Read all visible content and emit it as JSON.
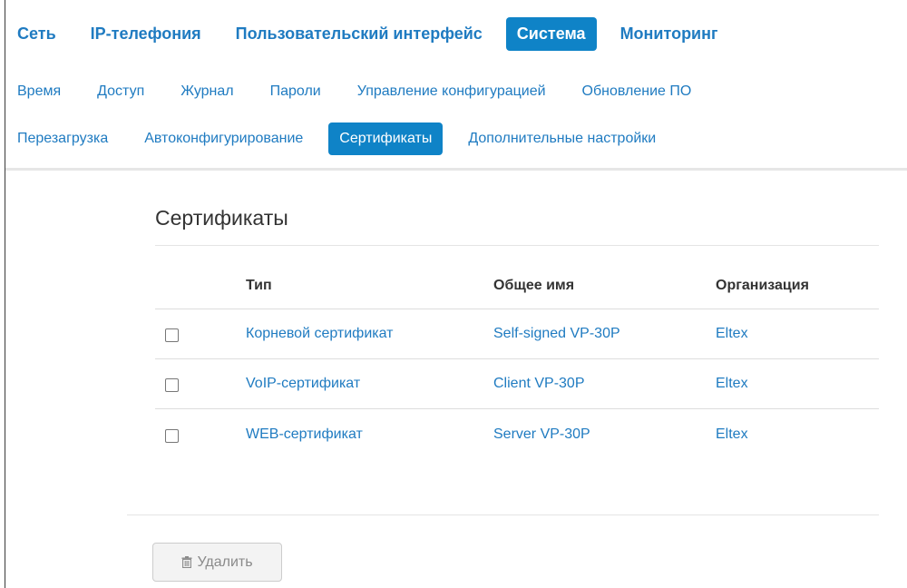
{
  "main_nav": {
    "items": [
      {
        "label": "Сеть",
        "active": false
      },
      {
        "label": "IP-телефония",
        "active": false
      },
      {
        "label": "Пользовательский интерфейс",
        "active": false
      },
      {
        "label": "Система",
        "active": true
      },
      {
        "label": "Мониторинг",
        "active": false
      }
    ]
  },
  "sub_nav": {
    "row1": [
      {
        "label": "Время"
      },
      {
        "label": "Доступ"
      },
      {
        "label": "Журнал"
      },
      {
        "label": "Пароли"
      },
      {
        "label": "Управление конфигурацией"
      },
      {
        "label": "Обновление ПО"
      }
    ],
    "row2": [
      {
        "label": "Перезагрузка"
      },
      {
        "label": "Автоконфигурирование"
      },
      {
        "label": "Сертификаты",
        "active": true
      },
      {
        "label": "Дополнительные настройки"
      }
    ]
  },
  "section": {
    "title": "Сертификаты"
  },
  "table": {
    "headers": [
      "Тип",
      "Общее имя",
      "Организация"
    ],
    "rows": [
      {
        "type": "Корневой сертификат",
        "common_name": "Self-signed VP-30P",
        "organization": "Eltex",
        "checked": false
      },
      {
        "type": "VoIP-сертификат",
        "common_name": "Client VP-30P",
        "organization": "Eltex",
        "checked": false
      },
      {
        "type": "WEB-сертификат",
        "common_name": "Server VP-30P",
        "organization": "Eltex",
        "checked": false
      }
    ]
  },
  "actions": {
    "delete_label": "Удалить",
    "delete_icon": "trash-icon"
  },
  "colors": {
    "accent": "#0f83c7",
    "link": "#1f7bc1"
  }
}
